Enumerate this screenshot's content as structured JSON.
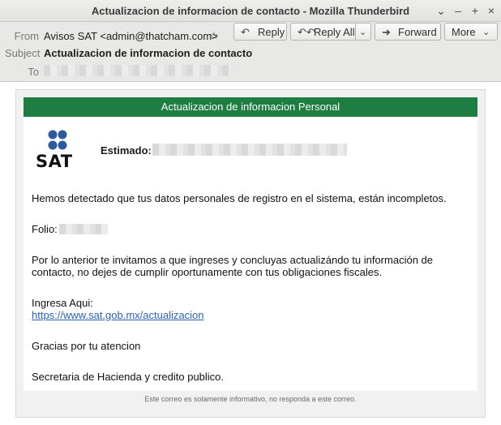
{
  "window": {
    "title": "Actualizacion de informacion de contacto - Mozilla Thunderbird",
    "controls": {
      "collapse": "⌄",
      "minimize": "–",
      "maximize": "+",
      "close": "×"
    }
  },
  "header": {
    "from_label": "From",
    "from_value": "Avisos SAT <admin@thatcham.com>",
    "subject_label": "Subject",
    "subject_value": "Actualizacion de informacion de contacto",
    "to_label": "To",
    "buttons": {
      "reply": "Reply",
      "reply_all": "Reply All",
      "forward": "Forward",
      "more": "More"
    },
    "icons": {
      "star": "star-icon",
      "reply": "reply-icon",
      "reply_all": "reply-all-icon",
      "forward": "forward-icon",
      "dropdown": "chevron-down-icon"
    }
  },
  "email": {
    "banner": "Actualizacion de informacion Personal",
    "logo_text": "SAT",
    "greeting_label": "Estimado:",
    "para1": "Hemos detectado que tus datos personales de registro en el sistema, están incompletos.",
    "folio_label": "Folio:",
    "para2_line1": "Por lo anterior te invitamos a que ingreses y concluyas actualizándo tu información de",
    "para2_line2": "contacto, no dejes de cumplir oportunamente con tus obligaciones fiscales.",
    "ingresa_label": "Ingresa Aqui:",
    "link": "https://www.sat.gob.mx/actualizacion",
    "thanks": "Gracias por tu atencion",
    "signature": "Secretaria de Hacienda y credito publico.",
    "footer": "Este correo es solamente informativo, no responda a este correo."
  },
  "colors": {
    "banner_green": "#1e7d40",
    "logo_blue": "#2c5aa0",
    "link_blue": "#2a62b8"
  }
}
